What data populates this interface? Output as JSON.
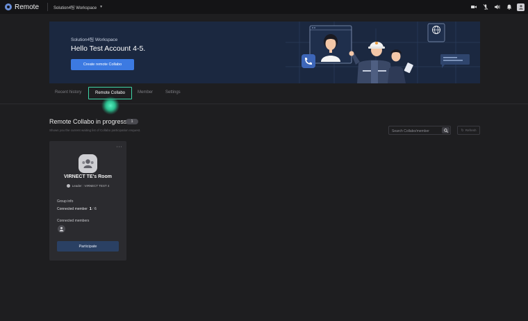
{
  "app": {
    "name": "Remote",
    "workspace": "Solution4팀 Workspace"
  },
  "topbar": {
    "icons": [
      "camera-icon",
      "mic-off-icon",
      "speaker-icon",
      "bell-icon",
      "user-avatar-icon"
    ]
  },
  "banner": {
    "workspace_label": "Solution4팀 Workspace",
    "greeting": "Hello Test Account 4-5.",
    "create_button": "Create remote Collabo"
  },
  "tabs": [
    {
      "label": "Recent history"
    },
    {
      "label": "Remote Collabo"
    },
    {
      "label": "Member"
    },
    {
      "label": "Settings"
    }
  ],
  "section": {
    "title": "Remote Collabo in progress",
    "count": "1",
    "subtitle": "Shows you the current waiting list of Collabo participation request.",
    "search_placeholder": "Search Collabo/member",
    "refresh_label": "Refresh"
  },
  "card": {
    "room_name": "VIRNECT TE's Room",
    "leader": "Leader : VIRNECT TEST 4",
    "group_info_label": "Group info",
    "connected_label": "Connected member",
    "connected_count": "1",
    "connected_max": "6",
    "members_label": "Connected members",
    "participate_label": "Participate"
  },
  "colors": {
    "accent": "#3c7ae2",
    "highlight": "#3fd6a8",
    "banner_bg": "#1b2840"
  }
}
